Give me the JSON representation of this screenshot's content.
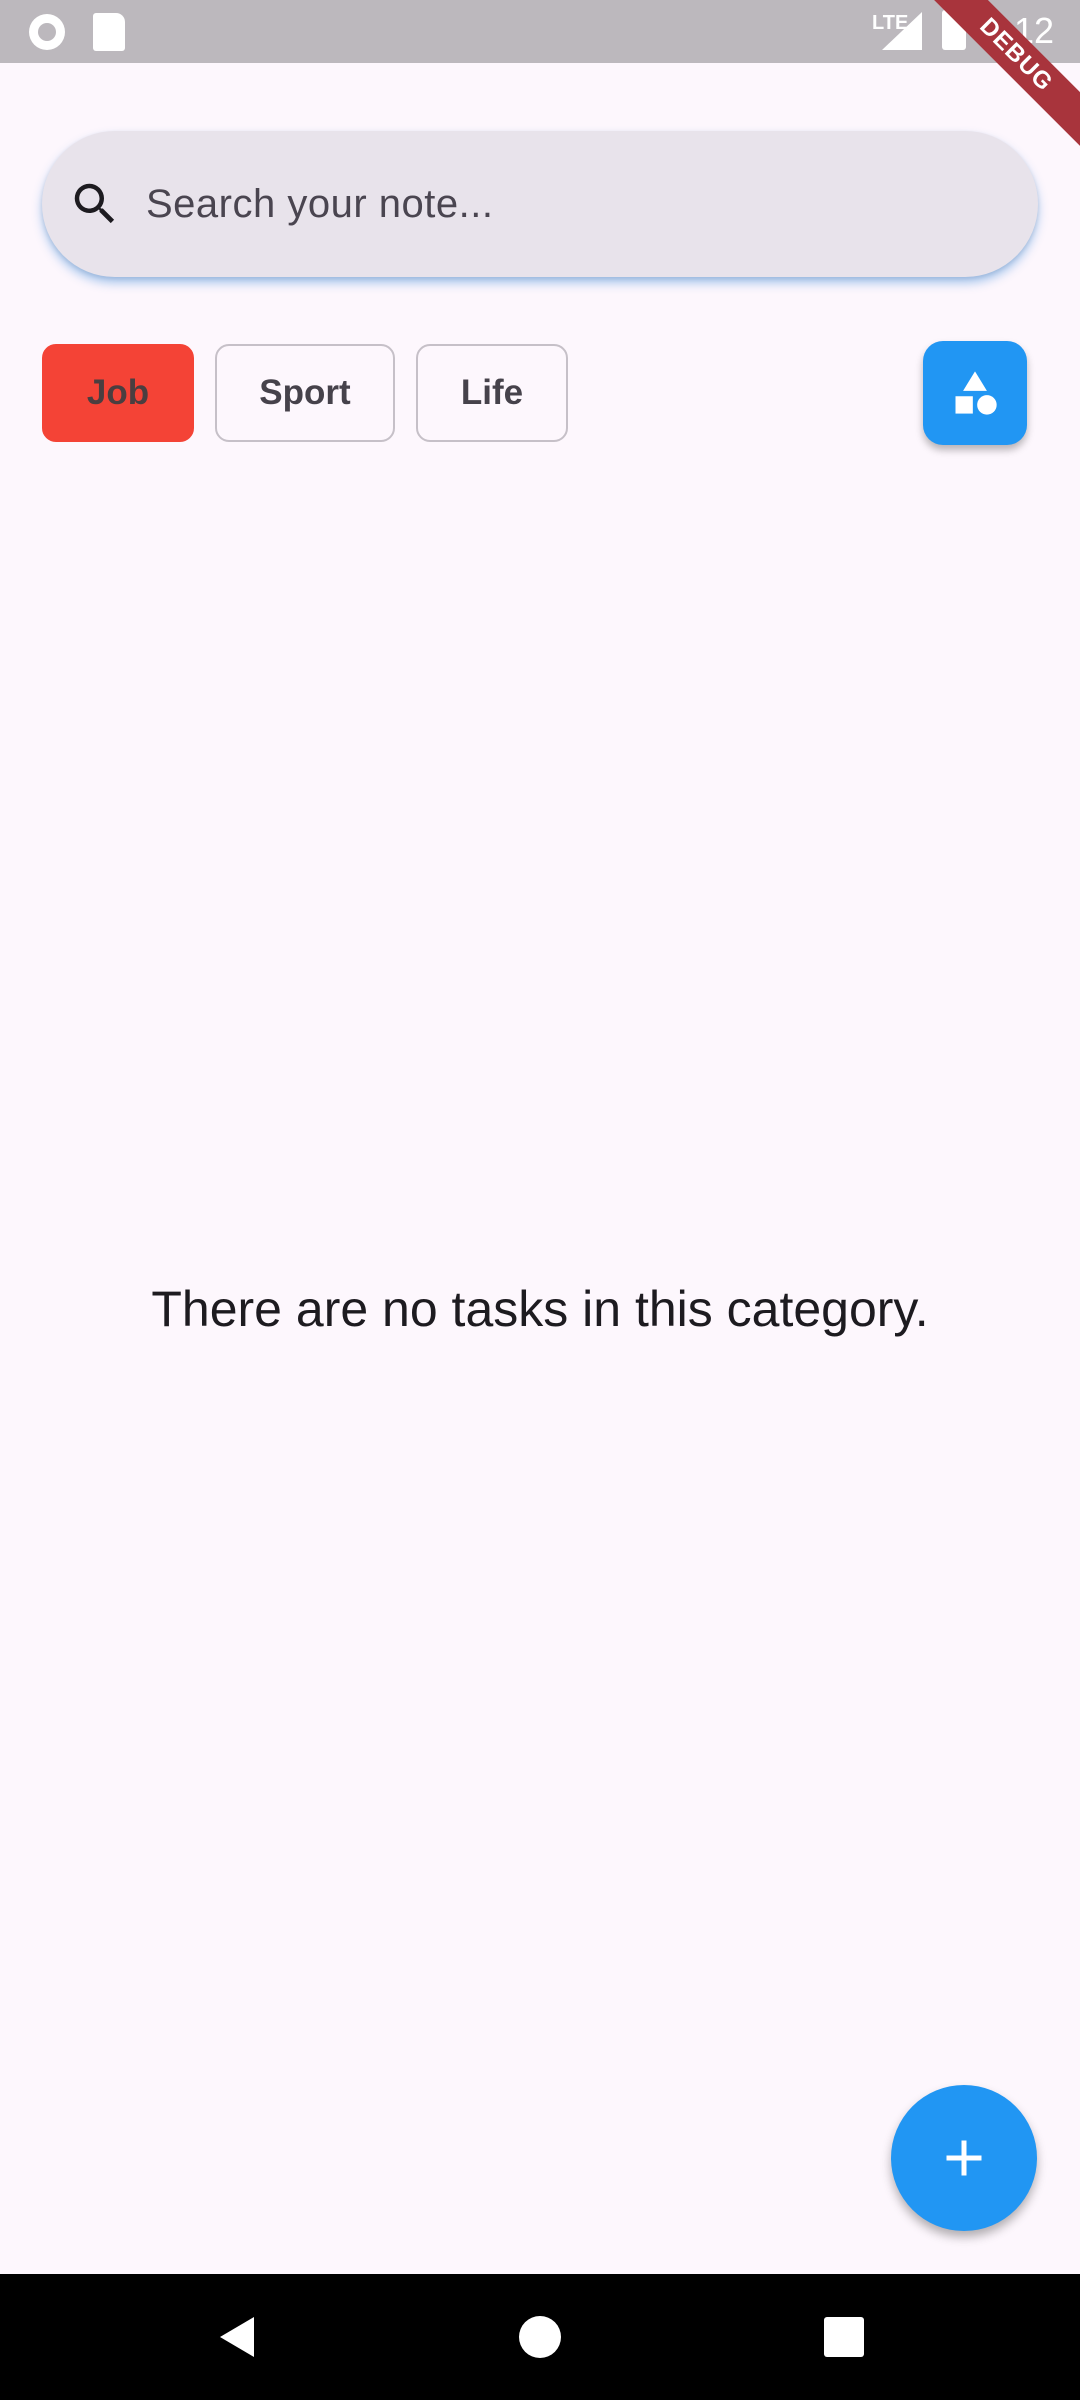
{
  "status_bar": {
    "network": "LTE",
    "time": "6:12"
  },
  "debug_banner": "DEBUG",
  "search": {
    "placeholder": "Search your note...",
    "value": ""
  },
  "categories": [
    {
      "label": "Job",
      "selected": true
    },
    {
      "label": "Sport",
      "selected": false
    },
    {
      "label": "Life",
      "selected": false
    }
  ],
  "shapes_button": {
    "icon": "category-shapes-icon"
  },
  "empty_state": {
    "message": "There are no tasks in this category."
  },
  "fab": {
    "icon": "plus-icon"
  },
  "colors": {
    "background": "#fdf7fd",
    "accent": "#2196f3",
    "selected_chip": "#f44336",
    "search_fill": "#e8e3eb",
    "debug_ribbon": "#a8343c"
  }
}
